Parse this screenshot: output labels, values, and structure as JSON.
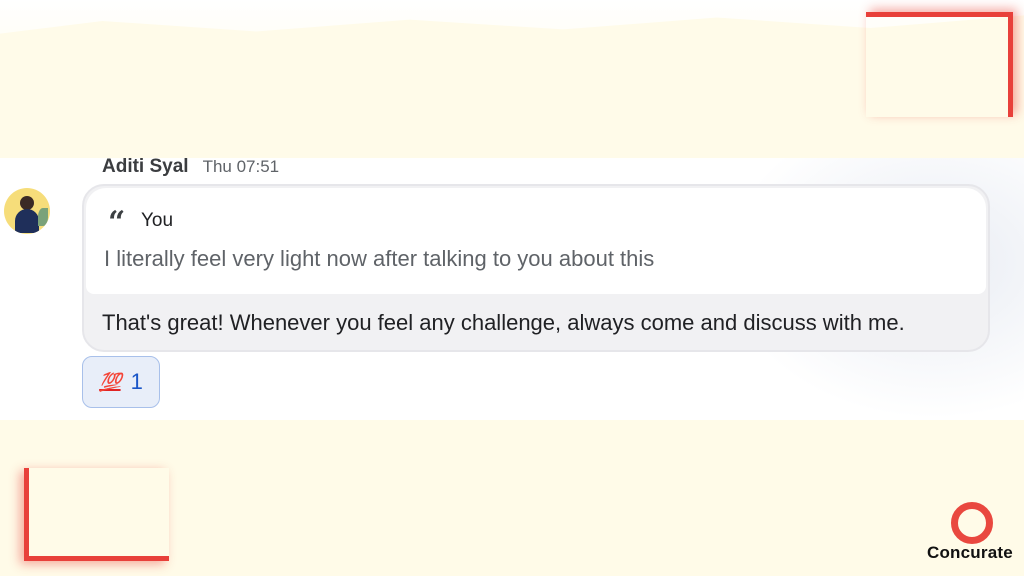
{
  "message": {
    "sender": "Aditi Syal",
    "timestamp": "Thu 07:51",
    "quote": {
      "icon": "quote-icon",
      "author": "You",
      "text": "I literally feel very light now after talking to you about this"
    },
    "text": "That's great! Whenever you feel any challenge, always come and discuss with me."
  },
  "reaction": {
    "emoji": "💯",
    "count": "1"
  },
  "brand": {
    "name": "Concurate",
    "accent": "#e9483f"
  }
}
